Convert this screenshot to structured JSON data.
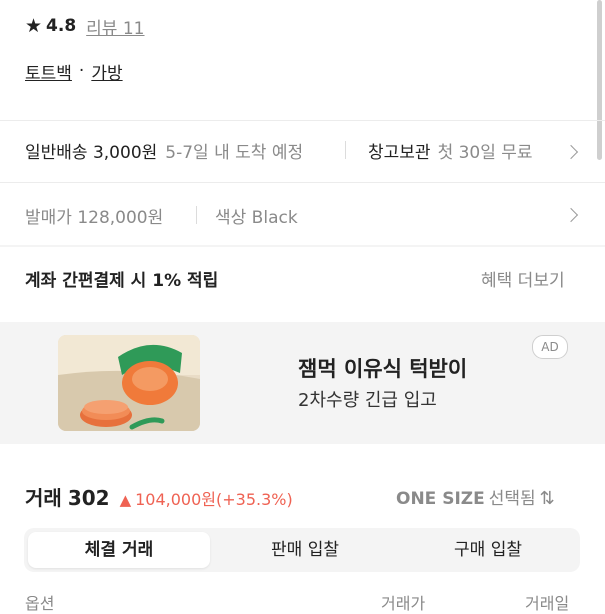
{
  "rating": {
    "icon": "star-icon",
    "score": "4.8",
    "reviews_link": "리뷰 11"
  },
  "breadcrumb": {
    "category1": "토트백",
    "separator": "·",
    "category2": "가방"
  },
  "shipping": {
    "type": "일반배송 3,000원",
    "eta": "5-7일 내 도착 예정",
    "storage_label": "창고보관",
    "storage_value": "첫 30일 무료"
  },
  "product_info": {
    "release_price": "발매가 128,000원",
    "color": "색상 Black"
  },
  "benefit": {
    "text": "계좌 간편결제 시 1% 적립",
    "more_link": "혜택 더보기"
  },
  "ad": {
    "badge": "AD",
    "image_icon": "baby-bib-product-image",
    "title": "잼먹 이유식 턱받이",
    "subtitle": "2차수량 긴급 입고"
  },
  "trades": {
    "label": "거래",
    "count": "302",
    "arrow": "▲",
    "change": "104,000원(+35.3%)",
    "size_selector": "ONE SIZE",
    "size_suffix": "선택됨",
    "sort_icon": "up-down-arrow-icon",
    "tabs": [
      "체결 거래",
      "판매 입찰",
      "구매 입찰"
    ],
    "columns": [
      "옵션",
      "거래가",
      "거래일"
    ]
  },
  "colors": {
    "accent_red": "#ef6253",
    "bg_gray": "#f4f4f4"
  }
}
